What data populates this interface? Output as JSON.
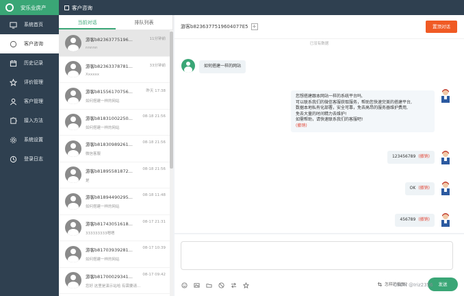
{
  "brand": {
    "name": "安乐业房产"
  },
  "topbar": {
    "title": "客户咨询"
  },
  "sidebar": {
    "items": [
      {
        "label": "系统首页",
        "icon": "monitor-icon"
      },
      {
        "label": "客户咨询",
        "icon": "chat-circle-icon"
      },
      {
        "label": "历史记录",
        "icon": "calendar-icon"
      },
      {
        "label": "评价管理",
        "icon": "star-icon"
      },
      {
        "label": "客户管理",
        "icon": "user-icon"
      },
      {
        "label": "接入方法",
        "icon": "puzzle-icon"
      },
      {
        "label": "系统设置",
        "icon": "gear-icon"
      },
      {
        "label": "登录日志",
        "icon": "clock-icon"
      }
    ]
  },
  "tabs": [
    {
      "label": "当前对话",
      "active": true
    },
    {
      "label": "排队列表",
      "active": false
    }
  ],
  "conversations": [
    {
      "name": "游客b82363775196...",
      "time": "11分钟前",
      "preview": "nnnnn"
    },
    {
      "name": "游客b82363378781...",
      "time": "33分钟前",
      "preview": "Xxxxxx"
    },
    {
      "name": "游客b81556170756...",
      "time": "昨天 17:38",
      "preview": "如何搭建一样的网站"
    },
    {
      "name": "游客b81831002250...",
      "time": "08-18 21:56",
      "preview": "如何搭建一样的网站"
    },
    {
      "name": "游客b81830989261...",
      "time": "08-18 21:56",
      "preview": "微信客服"
    },
    {
      "name": "游客b81895581872...",
      "time": "08-18 21:56",
      "preview": "是"
    },
    {
      "name": "游客b81894490295...",
      "time": "08-18 11:48",
      "preview": "如何搭建一样的网站"
    },
    {
      "name": "游客b81743051618...",
      "time": "08-17 21:31",
      "preview": "333333333嗯嗯"
    },
    {
      "name": "游客b81703939281...",
      "time": "08-17 10:39",
      "preview": "如何搭建一样的网站"
    },
    {
      "name": "游客b81700029341...",
      "time": "08-17 09:42",
      "preview": "您好 这里是演示站哈 有需要请..."
    }
  ],
  "chat": {
    "visitor_id": "游客b8236377519604077E5",
    "end_label": "置顶对话",
    "no_more": "已没有数据",
    "visitor_msg": "如何搭建一样的网站",
    "agent_reply_lines": [
      "您想搭建跟本网站一样的系统平台吗,",
      "可以联系我们的微信客服获取服务，帮助您快速完美的搭建平台,",
      "数据本地私有化部署，安全可靠，免去高昂的服务器维护费用,",
      "免去大量的时间精力去维护!",
      "如需帮助，请快速联系我们的客服吧!"
    ],
    "withdraw_label": "(撤销)",
    "msgs": [
      "123456789",
      "OK",
      "456789"
    ]
  },
  "input": {
    "hint": "怎样的截图?",
    "send_label": "发送"
  },
  "watermark": "CSDN @Iriz2356"
}
